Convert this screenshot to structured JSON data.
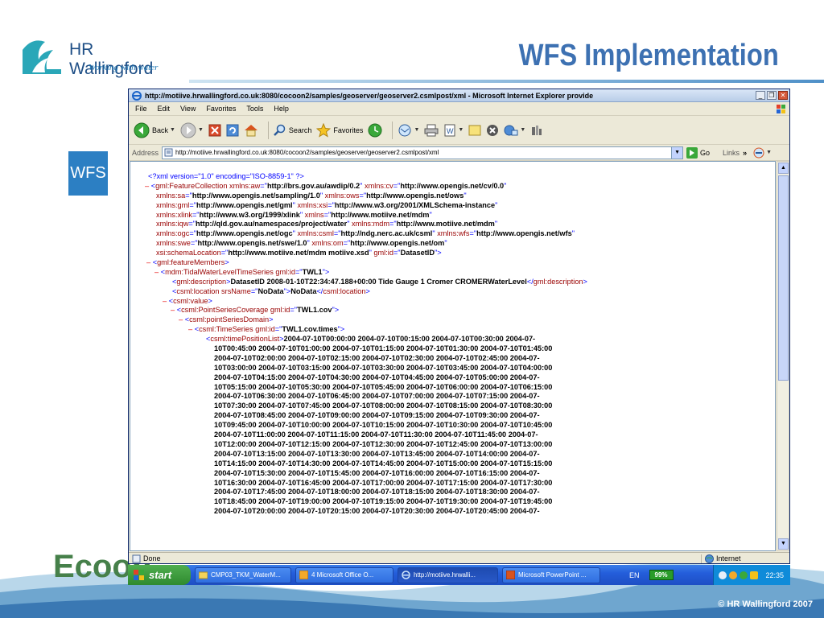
{
  "slide": {
    "title": "WFS Implementation",
    "logo_name": "HR Wallingford",
    "logo_tagline": "Working with water",
    "badge": "WFS",
    "bottom_logo": "Ecoop",
    "copyright": "© HR Wallingford 2007"
  },
  "browser": {
    "window_title": "http://motiive.hrwallingford.co.uk:8080/cocoon2/samples/geoserver/geoserver2.csmlpost/xml - Microsoft Internet Explorer provide",
    "menu": [
      "File",
      "Edit",
      "View",
      "Favorites",
      "Tools",
      "Help"
    ],
    "toolbar": {
      "back": "Back",
      "search": "Search",
      "favorites": "Favorites"
    },
    "address_label": "Address",
    "address": "http://motiive.hrwallingford.co.uk:8080/cocoon2/samples/geoserver/geoserver2.csmlpost/xml",
    "go": "Go",
    "links": "Links",
    "status": "Done",
    "zone": "Internet"
  },
  "xml": {
    "decl": "<?xml version=\"1.0\" encoding=\"ISO-8859-1\" ?>",
    "root_tag": "gml:FeatureCollection",
    "ns": [
      [
        [
          "xmlns:aw",
          "http://brs.gov.au/awdip/0.2"
        ],
        [
          "xmlns:cv",
          "http://www.opengis.net/cv/0.0"
        ]
      ],
      [
        [
          "xmlns:sa",
          "http://www.opengis.net/sampling/1.0"
        ],
        [
          "xmlns:ows",
          "http://www.opengis.net/ows"
        ]
      ],
      [
        [
          "xmlns:gml",
          "http://www.opengis.net/gml"
        ],
        [
          "xmlns:xsi",
          "http://www.w3.org/2001/XMLSchema-instance"
        ]
      ],
      [
        [
          "xmlns:xlink",
          "http://www.w3.org/1999/xlink"
        ],
        [
          "xmlns",
          "http://www.motiive.net/mdm"
        ]
      ],
      [
        [
          "xmlns:iqw",
          "http://qld.gov.au/namespaces/project/water"
        ],
        [
          "xmlns:mdm",
          "http://www.motiive.net/mdm"
        ]
      ],
      [
        [
          "xmlns:ogc",
          "http://www.opengis.net/ogc"
        ],
        [
          "xmlns:csml",
          "http://ndg.nerc.ac.uk/csml"
        ],
        [
          "xmlns:wfs",
          "http://www.opengis.net/wfs"
        ]
      ],
      [
        [
          "xmlns:swe",
          "http://www.opengis.net/swe/1.0"
        ],
        [
          "xmlns:om",
          "http://www.opengis.net/om"
        ]
      ],
      [
        [
          "xsi:schemaLocation",
          "http://www.motiive.net/mdm motiive.xsd"
        ],
        [
          "gml:id",
          "DatasetID"
        ]
      ]
    ],
    "feature_members": "gml:featureMembers",
    "series_tag": "mdm:TidalWaterLevelTimeSeries",
    "series_attr": "gml:id",
    "series_id": "TWL1",
    "desc_tag": "gml:description",
    "desc_text": "DatasetID 2008-01-10T22:34:47.188+00:00 Tide Gauge 1 Cromer CROMERWaterLevel",
    "loc_tag": "csml:location",
    "loc_attr": "srsName",
    "loc_attr_val": "NoData",
    "loc_text": "NoData",
    "value_tag": "csml:value",
    "psc_tag": "csml:PointSeriesCoverage",
    "psc_id": "TWL1.cov",
    "psd_tag": "csml:pointSeriesDomain",
    "ts_tag": "csml:TimeSeries",
    "ts_id": "TWL1.cov.times",
    "tpl_tag": "csml:timePositionList",
    "time_lines": [
      "2004-07-10T00:00:00 2004-07-10T00:15:00 2004-07-10T00:30:00 2004-07-",
      "10T00:45:00 2004-07-10T01:00:00 2004-07-10T01:15:00 2004-07-10T01:30:00 2004-07-10T01:45:00",
      "2004-07-10T02:00:00 2004-07-10T02:15:00 2004-07-10T02:30:00 2004-07-10T02:45:00 2004-07-",
      "10T03:00:00 2004-07-10T03:15:00 2004-07-10T03:30:00 2004-07-10T03:45:00 2004-07-10T04:00:00",
      "2004-07-10T04:15:00 2004-07-10T04:30:00 2004-07-10T04:45:00 2004-07-10T05:00:00 2004-07-",
      "10T05:15:00 2004-07-10T05:30:00 2004-07-10T05:45:00 2004-07-10T06:00:00 2004-07-10T06:15:00",
      "2004-07-10T06:30:00 2004-07-10T06:45:00 2004-07-10T07:00:00 2004-07-10T07:15:00 2004-07-",
      "10T07:30:00 2004-07-10T07:45:00 2004-07-10T08:00:00 2004-07-10T08:15:00 2004-07-10T08:30:00",
      "2004-07-10T08:45:00 2004-07-10T09:00:00 2004-07-10T09:15:00 2004-07-10T09:30:00 2004-07-",
      "10T09:45:00 2004-07-10T10:00:00 2004-07-10T10:15:00 2004-07-10T10:30:00 2004-07-10T10:45:00",
      "2004-07-10T11:00:00 2004-07-10T11:15:00 2004-07-10T11:30:00 2004-07-10T11:45:00 2004-07-",
      "10T12:00:00 2004-07-10T12:15:00 2004-07-10T12:30:00 2004-07-10T12:45:00 2004-07-10T13:00:00",
      "2004-07-10T13:15:00 2004-07-10T13:30:00 2004-07-10T13:45:00 2004-07-10T14:00:00 2004-07-",
      "10T14:15:00 2004-07-10T14:30:00 2004-07-10T14:45:00 2004-07-10T15:00:00 2004-07-10T15:15:00",
      "2004-07-10T15:30:00 2004-07-10T15:45:00 2004-07-10T16:00:00 2004-07-10T16:15:00 2004-07-",
      "10T16:30:00 2004-07-10T16:45:00 2004-07-10T17:00:00 2004-07-10T17:15:00 2004-07-10T17:30:00",
      "2004-07-10T17:45:00 2004-07-10T18:00:00 2004-07-10T18:15:00 2004-07-10T18:30:00 2004-07-",
      "10T18:45:00 2004-07-10T19:00:00 2004-07-10T19:15:00 2004-07-10T19:30:00 2004-07-10T19:45:00",
      "2004-07-10T20:00:00 2004-07-10T20:15:00 2004-07-10T20:30:00 2004-07-10T20:45:00 2004-07-"
    ]
  },
  "taskbar": {
    "start": "start",
    "items": [
      {
        "label": "CMP03_TKM_WaterM...",
        "active": false
      },
      {
        "label": "4 Microsoft Office O...",
        "active": false
      },
      {
        "label": "http://motiive.hrwalli...",
        "active": true
      },
      {
        "label": "Microsoft PowerPoint ...",
        "active": false
      }
    ],
    "lang": "EN",
    "battery": "99%",
    "clock": "22:35"
  }
}
